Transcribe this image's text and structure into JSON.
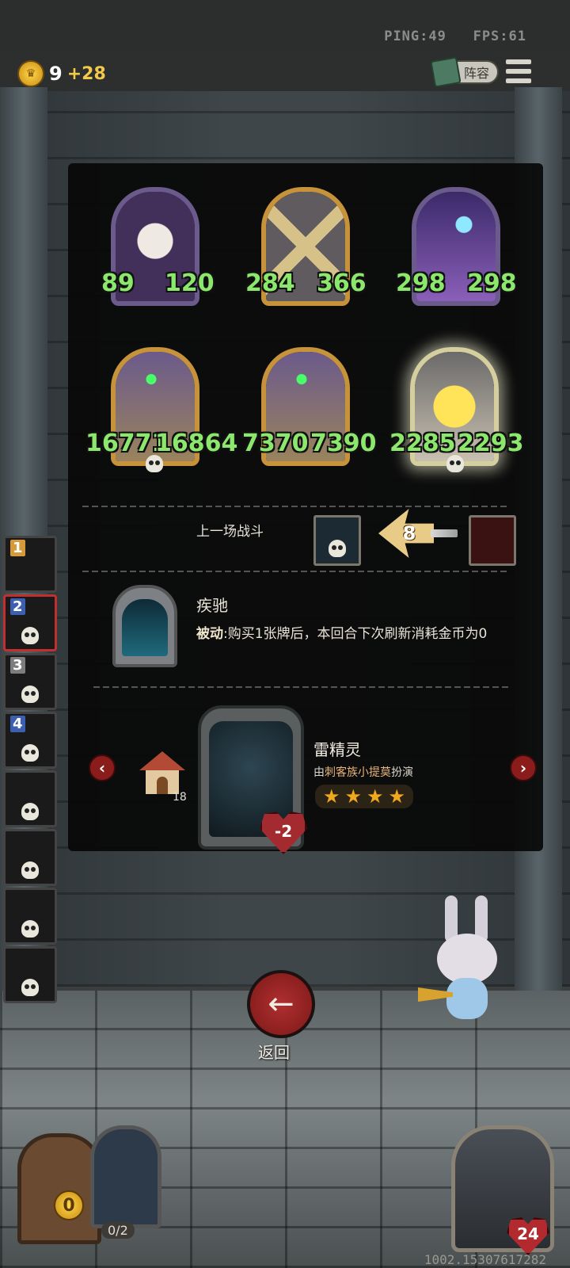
{
  "status": {
    "ping": "PING:49",
    "fps": "FPS:61"
  },
  "gold": {
    "value": "9",
    "income": "+28"
  },
  "top_buttons": {
    "lineup": "阵容"
  },
  "board": {
    "units": [
      {
        "attack": "89",
        "health": "120"
      },
      {
        "attack": "284",
        "health": "366"
      },
      {
        "attack": "298",
        "health": "298"
      },
      {
        "attack": "16771",
        "health": "16864"
      },
      {
        "attack": "7370",
        "health": "7390"
      },
      {
        "attack": "2285",
        "health": "2293"
      }
    ]
  },
  "last_battle": {
    "label": "上一场战斗",
    "damage": "8"
  },
  "skill": {
    "name": "疾驰",
    "type": "被动",
    "description": ":购买1张牌后，本回合下次刷新消耗金币为0"
  },
  "hero": {
    "name": "雷精灵",
    "subtitle_prefix": "由",
    "subtitle_tribe": "刺客族小提莫",
    "subtitle_suffix": "扮演",
    "stars": [
      "★",
      "★",
      "★",
      "★"
    ],
    "health_delta": "-2",
    "house_count": "18",
    "prev": "‹",
    "next": "›"
  },
  "roster": [
    {
      "rank": "1"
    },
    {
      "rank": "2"
    },
    {
      "rank": "3"
    },
    {
      "rank": "4"
    },
    {
      "rank": ""
    },
    {
      "rank": ""
    },
    {
      "rank": ""
    },
    {
      "rank": ""
    }
  ],
  "back": {
    "icon": "←",
    "label": "返回"
  },
  "shop": {
    "coins": "0",
    "slots": "0/2"
  },
  "opponent": {
    "health": "24"
  },
  "version": "1002.15307617282"
}
